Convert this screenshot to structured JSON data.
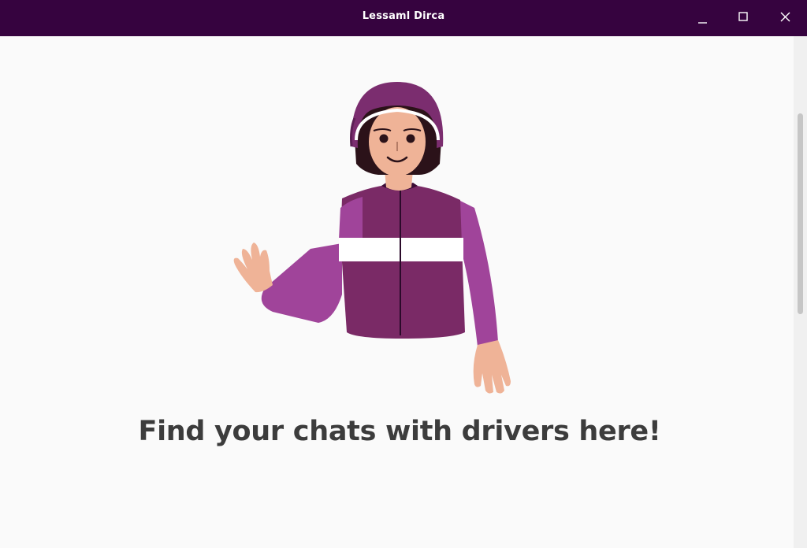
{
  "window": {
    "title": "Lessaml Dirca",
    "titlebar_color": "#36033f",
    "controls": [
      "minimize-icon",
      "maximize-icon",
      "close-icon"
    ]
  },
  "main": {
    "headline": "Find your chats with drivers here!",
    "illustration": "waving-driver-with-helmet",
    "colors": {
      "jacket": "#7a2a66",
      "sleeve": "#a0449a",
      "helmet": "#7b2d6f",
      "skin": "#efb397",
      "text": "#3c3c3c"
    }
  }
}
